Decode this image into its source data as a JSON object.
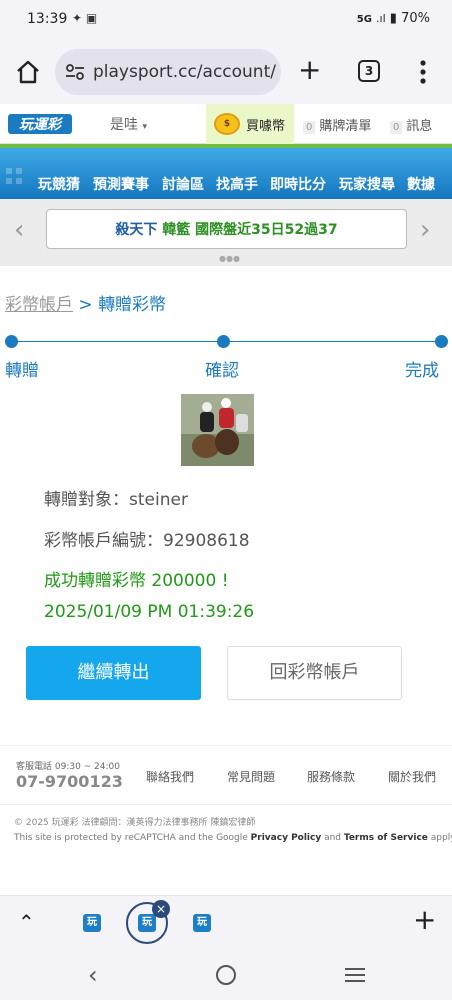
{
  "status_bar": {
    "time": "13:39",
    "network": "5G",
    "battery": "70%"
  },
  "browser": {
    "url": "playsport.cc/account/",
    "tab_count": "3"
  },
  "site_header": {
    "logo_text": "玩運彩",
    "user_label": "是哇",
    "buy_coin_label": "買噱幣",
    "cart_badge": "0",
    "cart_label": "購牌清單",
    "msg_badge": "0",
    "msg_label": "訊息"
  },
  "nav": {
    "items": [
      "玩競猜",
      "預測賽事",
      "討論區",
      "找高手",
      "即時比分",
      "玩家搜尋",
      "數據"
    ]
  },
  "marquee": {
    "name": "殺天下",
    "team": "韓籃",
    "text": "國際盤近35日52過37"
  },
  "breadcrumb": {
    "parent": "彩幣帳戶",
    "separator": ">",
    "current": "轉贈彩幣"
  },
  "steps": {
    "items": [
      "轉贈",
      "確認",
      "完成"
    ]
  },
  "transfer": {
    "recipient_label": "轉贈對象：steiner",
    "account_label": "彩幣帳戶編號：92908618",
    "success_message": "成功轉贈彩幣 200000 !",
    "datetime": "2025/01/09 PM 01:39:26"
  },
  "buttons": {
    "continue": "繼續轉出",
    "back_to_account": "回彩幣帳戶"
  },
  "footer": {
    "hotline_label": "客服電話 09:30 ~ 24:00",
    "hotline_number": "07-9700123",
    "links": [
      "聯絡我們",
      "常見問題",
      "服務條款",
      "關於我們"
    ],
    "copyright": "© 2025 玩運彩 法律顧問：漢英得力法律事務所 陳鎮宏律師",
    "recaptcha_prefix": "This site is protected by reCAPTCHA and the Google ",
    "privacy": "Privacy Policy",
    "and": " and ",
    "terms": "Terms of Service",
    "apply": " apply."
  },
  "colors": {
    "brand_blue": "#15a7ee",
    "link_blue": "#1a7bc0",
    "success_green": "#1f9a15",
    "nav_green": "#70bb44"
  }
}
